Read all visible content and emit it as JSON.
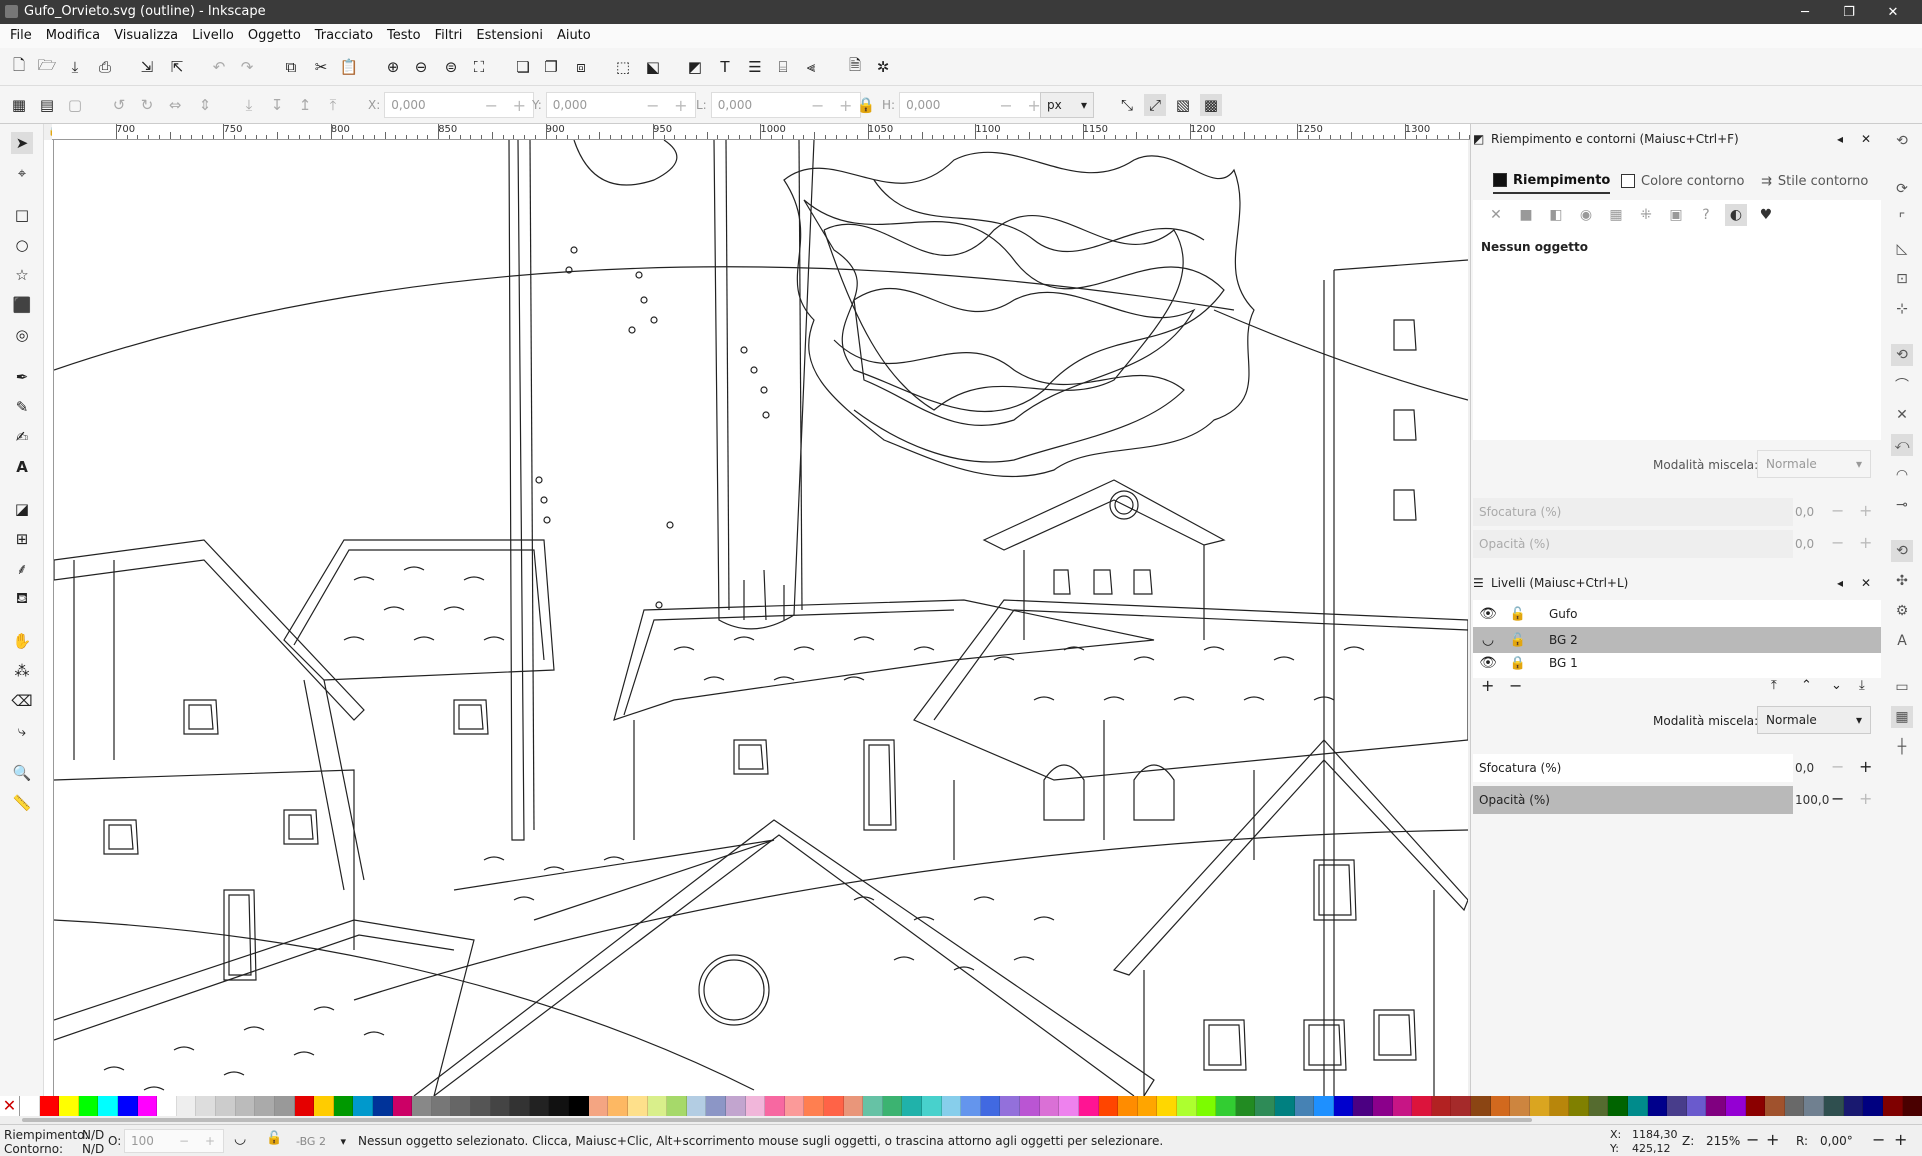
{
  "window": {
    "title": "Gufo_Orvieto.svg (outline) - Inkscape",
    "min": "─",
    "max": "❐",
    "close": "✕"
  },
  "menu": [
    "File",
    "Modifica",
    "Visualizza",
    "Livello",
    "Oggetto",
    "Tracciato",
    "Testo",
    "Filtri",
    "Estensioni",
    "Aiuto"
  ],
  "controls": {
    "x_label": "X:",
    "x_value": "0,000",
    "y_label": "Y:",
    "y_value": "0,000",
    "w_label": "L:",
    "w_value": "0,000",
    "h_label": "H:",
    "h_value": "0,000",
    "unit": "px"
  },
  "ruler": {
    "labels": [
      "700",
      "750",
      "800",
      "850",
      "900",
      "950",
      "1000",
      "1050",
      "1100",
      "1150",
      "1200",
      "1250",
      "1300"
    ]
  },
  "fill_stroke": {
    "title": "Riempimento e contorni (Maiusc+Ctrl+F)",
    "tabs": [
      "Riempimento",
      "Colore contorno",
      "Stile contorno"
    ],
    "no_object": "Nessun oggetto",
    "blend_label": "Modalità miscela:",
    "blend_value": "Normale",
    "blur_label": "Sfocatura (%)",
    "blur_value": "0,0",
    "opacity_label": "Opacità (%)",
    "opacity_value": "0,0"
  },
  "layers": {
    "title": "Livelli (Maiusc+Ctrl+L)",
    "rows": [
      {
        "name": "Gufo",
        "selected": false
      },
      {
        "name": "BG 2",
        "selected": true
      },
      {
        "name": "BG 1",
        "selected": false
      }
    ],
    "blend_label": "Modalità miscela:",
    "blend_value": "Normale",
    "blur_label": "Sfocatura (%)",
    "blur_value": "0,0",
    "opacity_label": "Opacità (%)",
    "opacity_value": "100,0"
  },
  "palette": [
    "#ffffff",
    "#ff0000",
    "#ffff00",
    "#00ff00",
    "#00ffff",
    "#0000ff",
    "#ff00ff",
    "#ffffff",
    "#eeeeee",
    "#dddddd",
    "#cccccc",
    "#bbbbbb",
    "#aaaaaa",
    "#999999",
    "#e50000",
    "#ffcc00",
    "#009900",
    "#0099cc",
    "#003399",
    "#cc0066",
    "#888888",
    "#777777",
    "#666666",
    "#555555",
    "#444444",
    "#333333",
    "#222222",
    "#111111",
    "#000000",
    "#f4a582",
    "#fdb863",
    "#fee08b",
    "#d9ef8b",
    "#a6d96a",
    "#b3cde3",
    "#8c96c6",
    "#c2a5cf",
    "#f1b6da",
    "#f768a1",
    "#fb9a99",
    "#ff7f50",
    "#ff6347",
    "#e9967a",
    "#66c2a5",
    "#3cb371",
    "#20b2aa",
    "#48d1cc",
    "#87ceeb",
    "#6495ed",
    "#4169e1",
    "#9370db",
    "#ba55d3",
    "#da70d6",
    "#ee82ee",
    "#ff1493",
    "#ff4500",
    "#ff8c00",
    "#ffa500",
    "#ffd700",
    "#adff2f",
    "#7cfc00",
    "#32cd32",
    "#228b22",
    "#2e8b57",
    "#008080",
    "#4682b4",
    "#1e90ff",
    "#0000cd",
    "#4b0082",
    "#8b008b",
    "#c71585",
    "#dc143c",
    "#b22222",
    "#a52a2a",
    "#8b4513",
    "#d2691e",
    "#cd853f",
    "#daa520",
    "#b8860b",
    "#808000",
    "#556b2f",
    "#006400",
    "#008b8b",
    "#00008b",
    "#483d8b",
    "#6a5acd",
    "#800080",
    "#9400d3",
    "#8b0000",
    "#a0522d",
    "#696969",
    "#708090",
    "#2f4f4f",
    "#191970",
    "#000080",
    "#7f0000",
    "#4a0000"
  ],
  "status": {
    "fill_label": "Riempimento:",
    "fill_value": "N/D",
    "stroke_label": "Contorno:",
    "stroke_value": "N/D",
    "o_label": "O:",
    "o_value": "100",
    "layer": "-BG 2",
    "message": "Nessun oggetto selezionato. Clicca, Maiusc+Clic, Alt+scorrimento mouse sugli oggetti, o trascina attorno agli oggetti per selezionare.",
    "x_label": "X:",
    "x_value": "1184,30",
    "y_label": "Y:",
    "y_value": "425,12",
    "z_label": "Z:",
    "zoom": "215%",
    "r_label": "R:",
    "rotation": "0,00°"
  }
}
